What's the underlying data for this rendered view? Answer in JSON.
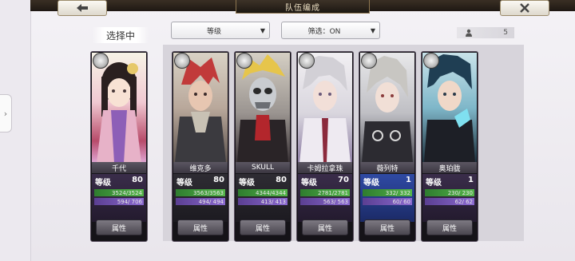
{
  "header": {
    "title": "队伍编成",
    "back_icon": "back-arrow-icon",
    "close_icon": "close-icon"
  },
  "left_panel": {
    "selecting_label": "选择中"
  },
  "toolbar": {
    "sort_label": "等级",
    "filter_label": "筛选：ON",
    "party_count": "5"
  },
  "colors": {
    "hp_bar": "#55b54a",
    "mp_bar": "#8b6ad0",
    "rare_card": "#2f4aa4",
    "selected_card": "#3a2d4a"
  },
  "characters": [
    {
      "name": "千代",
      "level_label": "等级",
      "level": "80",
      "hp": "3524/3524",
      "mp": "594/ 706",
      "attr_label": "属性"
    },
    {
      "name": "维克多",
      "level_label": "等级",
      "level": "80",
      "hp": "3563/3563",
      "mp": "494/ 494",
      "attr_label": "属性"
    },
    {
      "name": "SKULL",
      "level_label": "等级",
      "level": "80",
      "hp": "4344/4344",
      "mp": "413/ 413",
      "attr_label": "属性"
    },
    {
      "name": "卡姆拉拿珠",
      "level_label": "等级",
      "level": "70",
      "hp": "2781/2781",
      "mp": "563/ 563",
      "attr_label": "属性"
    },
    {
      "name": "薇列特",
      "level_label": "等级",
      "level": "1",
      "hp": "332/ 332",
      "mp": "60/ 60",
      "attr_label": "属性"
    },
    {
      "name": "奥珀胧",
      "level_label": "等级",
      "level": "1",
      "hp": "230/ 230",
      "mp": "62/ 62",
      "attr_label": "属性"
    }
  ]
}
